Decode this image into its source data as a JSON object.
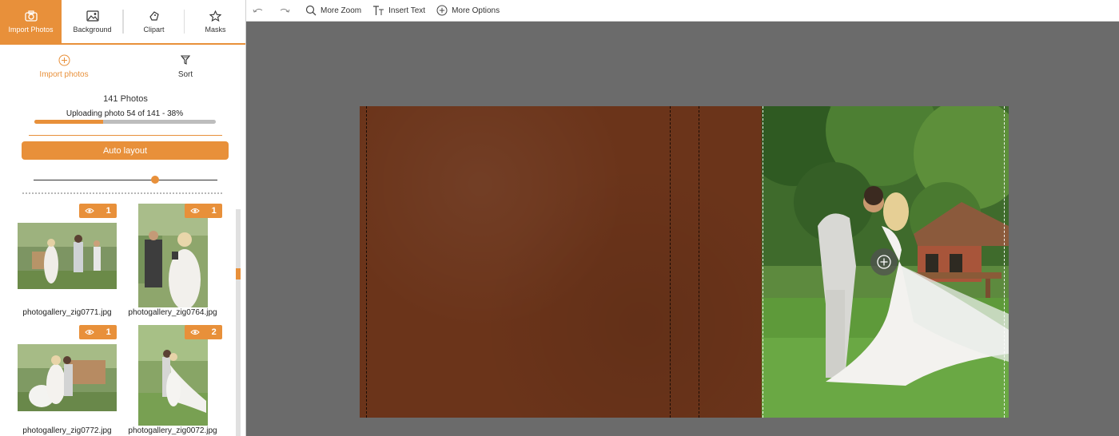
{
  "tabs": [
    {
      "label": "Import Photos",
      "icon": "camera-icon",
      "active": true
    },
    {
      "label": "Background",
      "icon": "image-icon",
      "active": false
    },
    {
      "label": "Clipart",
      "icon": "clipart-icon",
      "active": false
    },
    {
      "label": "Masks",
      "icon": "star-icon",
      "active": false
    }
  ],
  "actions": {
    "import_label": "Import photos",
    "sort_label": "Sort"
  },
  "photos": {
    "count_text": "141 Photos",
    "upload_status": "Uploading photo 54 of 141 - 38%",
    "progress_percent": 38
  },
  "auto_layout_label": "Auto layout",
  "slider_value_percent": 66,
  "thumbnails": [
    {
      "filename": "photogallery_zig0771.jpg",
      "uses": "1"
    },
    {
      "filename": "photogallery_zig0764.jpg",
      "uses": "1"
    },
    {
      "filename": "photogallery_zig0772.jpg",
      "uses": "1"
    },
    {
      "filename": "photogallery_zig0072.jpg",
      "uses": "2"
    }
  ],
  "toolbar": {
    "undo_icon": "undo-icon",
    "redo_icon": "redo-icon",
    "zoom_label": "More Zoom",
    "text_label": "Insert Text",
    "options_label": "More Options"
  },
  "colors": {
    "accent": "#e8903a",
    "leather": "#6b341a",
    "workspace": "#6b6b6b"
  }
}
